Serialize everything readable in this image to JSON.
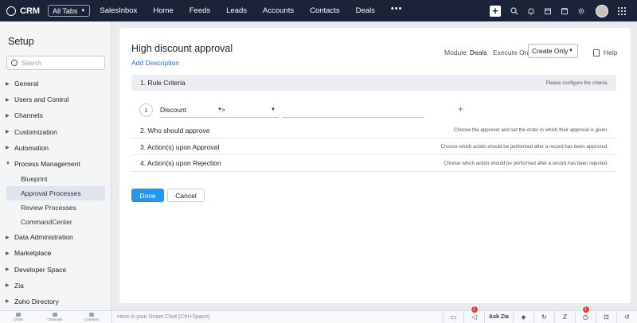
{
  "topbar": {
    "app_name": "CRM",
    "all_tabs_label": "All Tabs",
    "nav": [
      "SalesInbox",
      "Home",
      "Feeds",
      "Leads",
      "Accounts",
      "Contacts",
      "Deals"
    ],
    "more_label": "•••"
  },
  "sidebar": {
    "title": "Setup",
    "search_placeholder": "Search",
    "items": [
      {
        "label": "General"
      },
      {
        "label": "Users and Control"
      },
      {
        "label": "Channels"
      },
      {
        "label": "Customization"
      },
      {
        "label": "Automation"
      },
      {
        "label": "Process Management"
      }
    ],
    "sub_items": [
      {
        "label": "Blueprint"
      },
      {
        "label": "Approval Processes"
      },
      {
        "label": "Review Processes"
      },
      {
        "label": "CommandCenter"
      }
    ],
    "items_after": [
      {
        "label": "Data Administration"
      },
      {
        "label": "Marketplace"
      },
      {
        "label": "Developer Space"
      },
      {
        "label": "Zia"
      },
      {
        "label": "Zoho Directory"
      }
    ]
  },
  "main": {
    "title": "High discount approval",
    "add_description": "Add Description",
    "module_label": "Module",
    "module_value": "Deals",
    "execute_on_label": "Execute On",
    "execute_on_value": "Create Only",
    "help_label": "Help",
    "steps": [
      {
        "label": "1.  Rule Criteria",
        "hint": "Please configure the criteria."
      },
      {
        "label": "2.  Who should approve",
        "hint": "Choose the approver and set the order in which their approval is given."
      },
      {
        "label": "3.  Action(s) upon Approval",
        "hint": "Choose which action should be performed after a record has been approved."
      },
      {
        "label": "4.  Action(s) upon Rejection",
        "hint": "Choose which action should be performed after a record has been rejected."
      }
    ],
    "criteria": {
      "number": "1",
      "field": "Discount",
      "operator": ">",
      "value": "",
      "add_symbol": "+"
    },
    "done_label": "Done",
    "cancel_label": "Cancel"
  },
  "bottombar": {
    "tabs": [
      "Chats",
      "Channels",
      "Contacts"
    ],
    "smart_chat_placeholder": "Here is your Smart Chat (Ctrl+Space)",
    "ask_zia": "Ask Zia",
    "badge_1": "1",
    "badge_2": "1"
  }
}
